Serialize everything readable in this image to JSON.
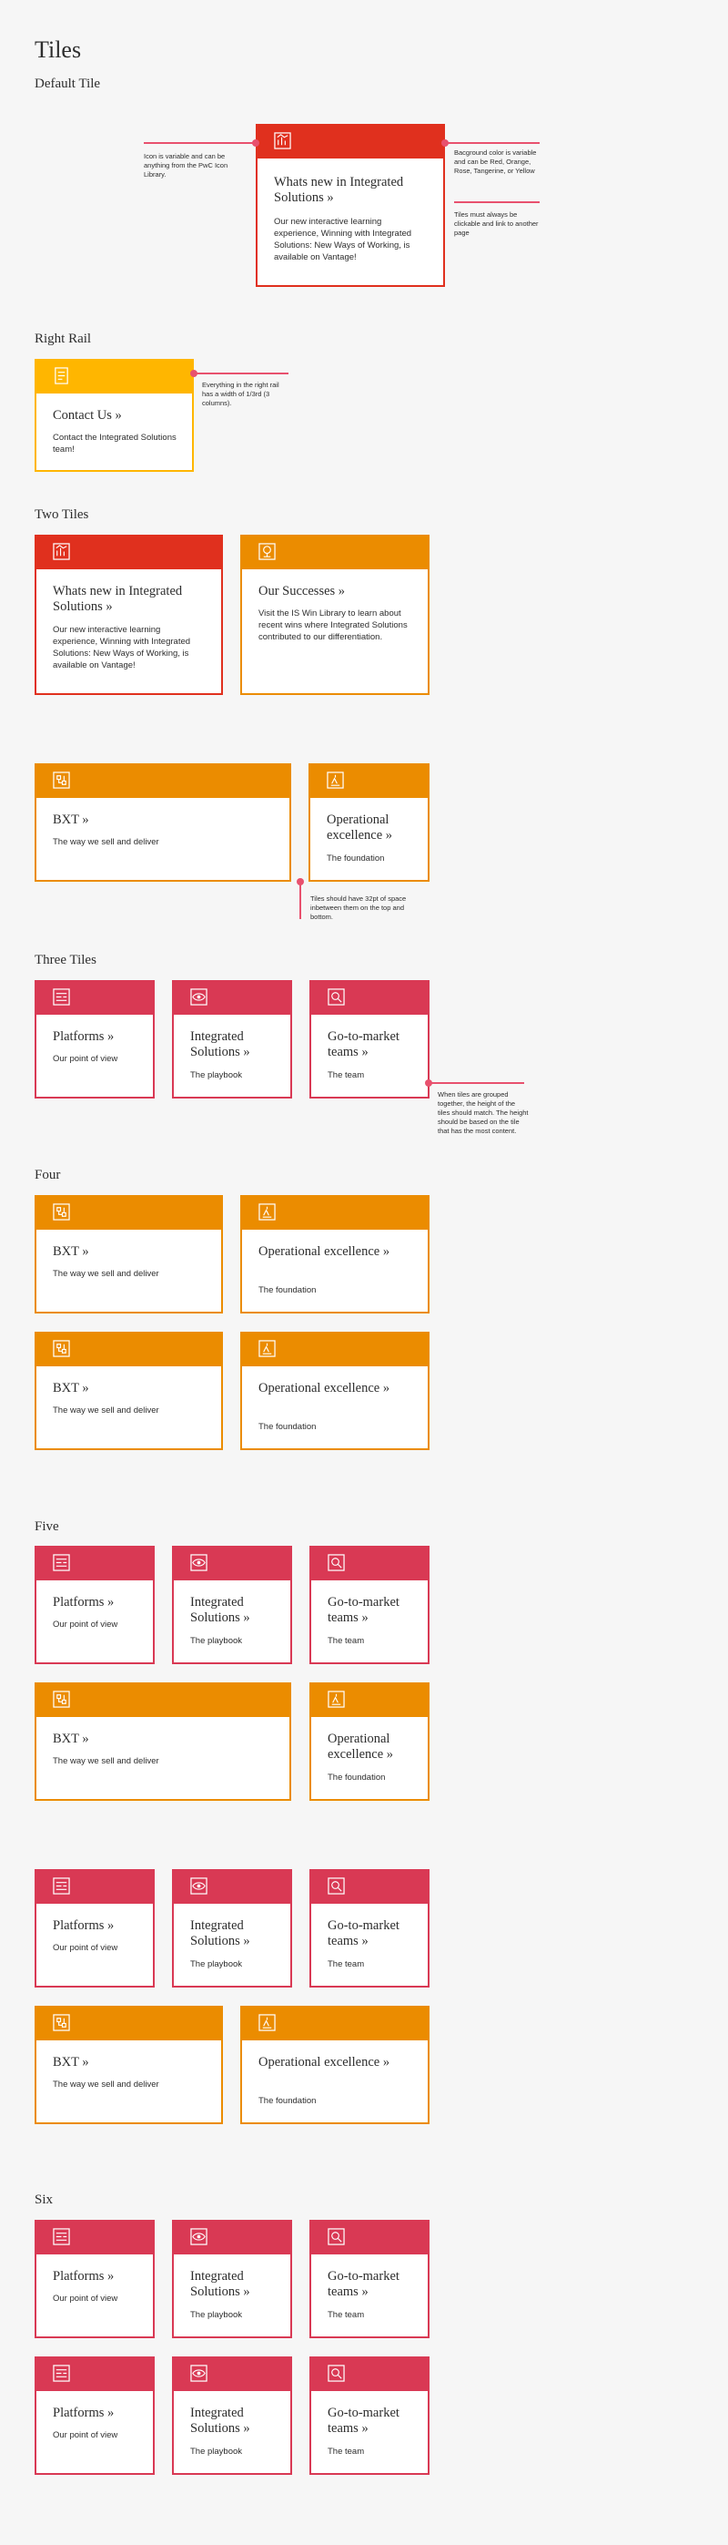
{
  "title": "Tiles",
  "sections": {
    "default": "Default Tile",
    "right_rail": "Right Rail",
    "two": "Two Tiles",
    "three": "Three Tiles",
    "four": "Four",
    "five": "Five",
    "six": "Six"
  },
  "notes": {
    "icon": "Icon is variable and can be anything from the PwC Icon Library.",
    "bg": "Bacground color is variable and can be Red, Orange, Rose, Tangerine, or Yellow",
    "click": "Tiles must always be clickable and link to another page",
    "rail": "Everything in the right rail has a width of 1/3rd (3 columns).",
    "space": "Tiles should have 32pt of space inbetween them on the top and bottom.",
    "height": "When tiles are grouped together, the height of the tiles should match. The height should be based on the tile that has the most content."
  },
  "tiles": {
    "whats_new": {
      "title": "Whats new in Integrated Solutions »",
      "sub": "Our new interactive learning experience, Winning with Integrated Solutions: New Ways of Working, is available on Vantage!"
    },
    "contact": {
      "title": "Contact Us »",
      "sub": "Contact the Integrated Solutions team!"
    },
    "successes": {
      "title": "Our Successes »",
      "sub": "Visit the IS Win Library to learn about recent wins where Integrated Solutions contributed to our differentiation."
    },
    "bxt": {
      "title": "BXT »",
      "sub": "The way we sell and deliver"
    },
    "opex": {
      "title": "Operational excellence »",
      "sub": "The foundation"
    },
    "platforms": {
      "title": "Platforms »",
      "sub": "Our point of view"
    },
    "integrated": {
      "title": "Integrated Solutions »",
      "sub": "The playbook"
    },
    "gtm": {
      "title": "Go-to-market teams »",
      "sub": "The team"
    }
  },
  "colors": {
    "red": "#e0301e",
    "orange": "#eb8c00",
    "yellow": "#ffb600",
    "rose": "#d93954",
    "annotation": "#e8516e"
  },
  "icons": [
    "chart-icon",
    "document-icon",
    "trophy-icon",
    "flowchart-icon",
    "hand-award-icon",
    "dashboard-icon",
    "eye-icon",
    "person-search-icon"
  ]
}
